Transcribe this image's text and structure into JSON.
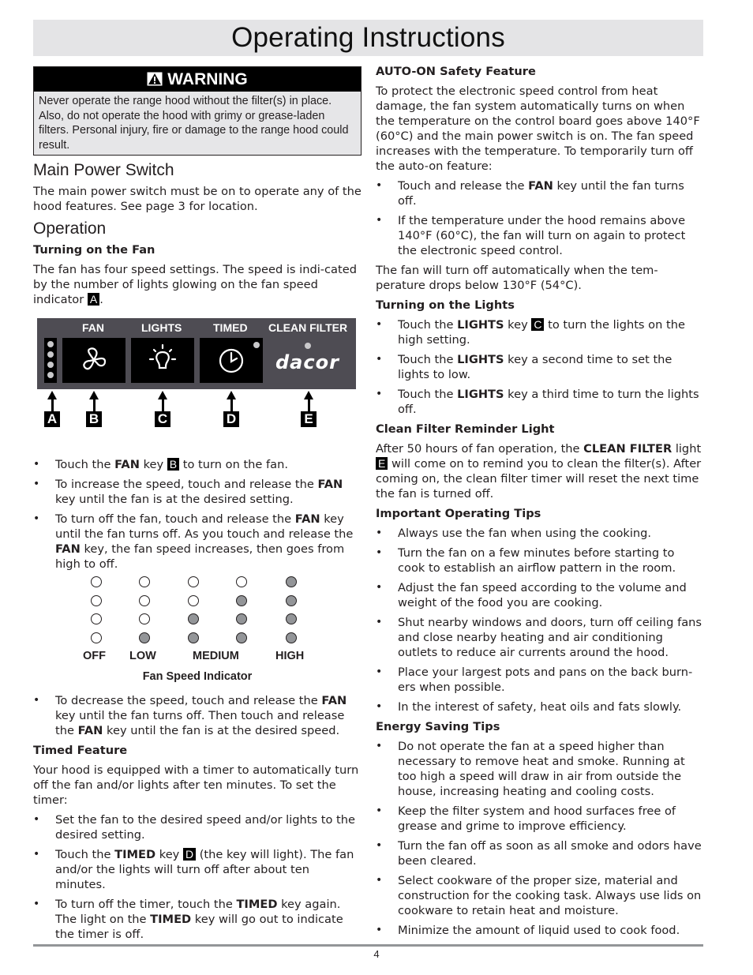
{
  "page": {
    "title": "Operating Instructions",
    "page_number": "4"
  },
  "warning": {
    "icon": "warning-triangle-icon",
    "heading": "WARNING",
    "text": "Never operate the range hood without the filter(s) in place. Also, do not operate the hood with grimy or grease-laden filters. Personal injury, fire or damage to the range hood could result."
  },
  "main_power": {
    "heading": "Main Power Switch",
    "text": "The main power switch must be on to operate any of the hood features. See page 3 for location."
  },
  "operation": {
    "heading": "Operation",
    "turning_on_fan": {
      "heading": "Turning on the Fan",
      "intro_pre": "The fan has four speed settings. The speed is indi-cated by the number of lights glowing on the fan speed indicator ",
      "intro_tag": "A",
      "intro_post": "."
    },
    "panel": {
      "labels": [
        "FAN",
        "LIGHTS",
        "TIMED",
        "CLEAN FILTER"
      ],
      "logo": "dacor",
      "callouts": [
        "A",
        "B",
        "C",
        "D",
        "E"
      ],
      "indicator_lights": 4
    },
    "fan_bullets": [
      {
        "pre": "Touch the ",
        "bold": "FAN",
        "mid": " key ",
        "tag": "B",
        "post": " to turn on the fan."
      },
      {
        "pre": "To increase the speed, touch and release the ",
        "bold": "FAN",
        "post": " key until the fan is at the desired setting."
      },
      {
        "pre": "To turn off the fan, touch and release the ",
        "bold": "FAN",
        "mid": " key until the fan turns off. As you touch and release the ",
        "bold2": "FAN",
        "post": " key, the fan speed increases, then goes from high to off."
      }
    ],
    "fan_speed_indicator": {
      "caption": "Fan Speed Indicator",
      "levels": [
        {
          "label": "OFF",
          "lit": 0
        },
        {
          "label": "LOW",
          "lit": 1
        },
        {
          "label": "",
          "lit": 2
        },
        {
          "label": "",
          "lit": 3
        },
        {
          "label": "HIGH",
          "lit": 4
        }
      ],
      "medium_label": "MEDIUM",
      "total_lights": 4
    },
    "decrease_bullet": {
      "pre": "To decrease the speed, touch and release the ",
      "bold": "FAN",
      "mid": " key until the fan turns off. Then touch and release the ",
      "bold2": "FAN",
      "post": " key until the fan is at the desired speed."
    },
    "timed": {
      "heading": "Timed Feature",
      "intro": "Your hood is equipped with a timer to automatically turn off the fan and/or lights after ten minutes. To set the timer:",
      "bullets": [
        {
          "pre": "Set the fan to the desired speed and/or lights to the desired setting."
        },
        {
          "pre": "Touch the ",
          "bold": "TIMED",
          "mid": " key ",
          "tag": "D",
          "post": " (the key will light). The fan and/or the lights will turn off after about ten minutes."
        },
        {
          "pre": "To turn off the timer, touch the ",
          "bold": "TIMED",
          "mid": " key again. The light on the ",
          "bold2": "TIMED",
          "post": " key will go out to indicate the timer is off."
        }
      ]
    }
  },
  "auto_on": {
    "heading": "AUTO-ON Safety Feature",
    "intro": "To protect the electronic speed control from heat damage, the fan system automatically turns on when the temperature on the control board goes above 140°F (60°C) and the main power switch is on. The fan speed increases with the temperature. To temporarily turn off the auto-on feature:",
    "bullets": [
      {
        "pre": "Touch and release the ",
        "bold": "FAN",
        "post": " key until the fan turns off."
      },
      {
        "pre": "If the temperature under the hood remains above 140°F (60°C), the fan will turn on again to protect the electronic speed control."
      }
    ],
    "outro": "The fan will turn off automatically when the tem-perature drops below 130°F (54°C)."
  },
  "lights": {
    "heading": "Turning on the Lights",
    "bullets": [
      {
        "pre": "Touch the ",
        "bold": "LIGHTS",
        "mid": " key ",
        "tag": "C",
        "post": " to turn the lights on the high setting."
      },
      {
        "pre": "Touch the ",
        "bold": "LIGHTS",
        "post": " key a second time to set the lights to low."
      },
      {
        "pre": "Touch the ",
        "bold": "LIGHTS",
        "post": " key a third time to turn the lights off."
      }
    ]
  },
  "clean_filter": {
    "heading": "Clean Filter Reminder Light",
    "pre": "After 50 hours of fan operation, the ",
    "bold": "CLEAN FILTER",
    "mid": " light ",
    "tag": "E",
    "post": " will come on to remind you to clean the filter(s). After coming on, the clean filter timer will reset the next time the fan is turned off."
  },
  "operating_tips": {
    "heading": "Important Operating Tips",
    "bullets": [
      "Always use the fan when using the cooking.",
      "Turn the fan on a few minutes before starting to cook to establish an airflow pattern in the room.",
      "Adjust the fan speed according to the volume and weight of the food you are cooking.",
      "Shut nearby windows and doors, turn off ceiling fans and close nearby heating and air conditioning outlets to reduce air currents around the hood.",
      "Place your largest pots and pans on the back burn-ers when possible.",
      "In the interest of safety, heat oils and fats slowly."
    ]
  },
  "energy_tips": {
    "heading": "Energy Saving Tips",
    "bullets": [
      "Do not operate the fan at a speed higher than necessary to remove heat and smoke. Running at too high a speed will draw in air from outside the house, increasing heating and cooling costs.",
      "Keep the filter system and hood surfaces free of grease and grime to improve efficiency.",
      "Turn the fan off as soon as all smoke and odors have been cleared.",
      "Select cookware of the proper size, material and construction for the cooking task. Always use lids on cookware to retain heat and moisture.",
      "Minimize the amount of liquid used to cook food."
    ]
  }
}
